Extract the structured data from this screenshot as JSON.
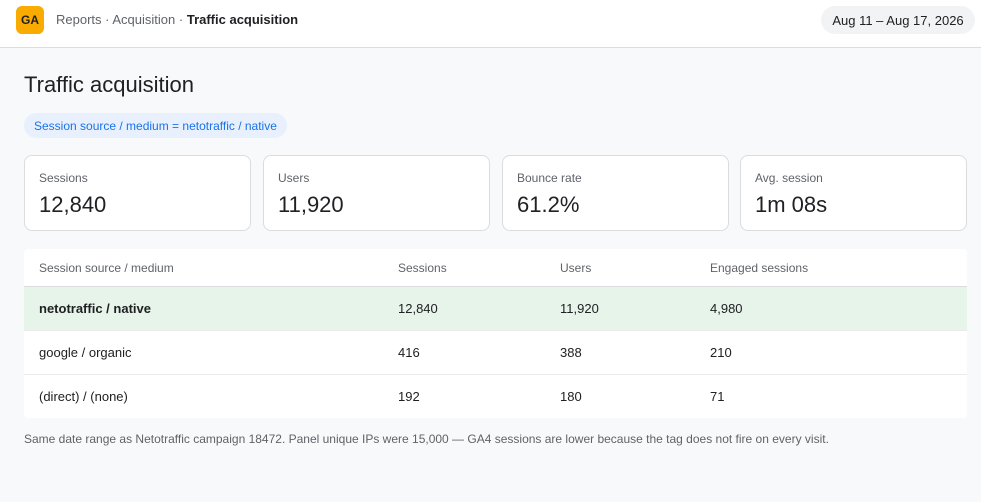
{
  "header": {
    "logo_text": "GA",
    "breadcrumbs": [
      "Reports",
      "Acquisition",
      "Traffic acquisition"
    ],
    "date_range": "Aug 11 – Aug 17, 2026"
  },
  "page": {
    "title": "Traffic acquisition",
    "filter": "Session source / medium = netotraffic / native"
  },
  "metrics": [
    {
      "label": "Sessions",
      "value": "12,840"
    },
    {
      "label": "Users",
      "value": "11,920"
    },
    {
      "label": "Bounce rate",
      "value": "61.2%"
    },
    {
      "label": "Avg. session",
      "value": "1m 08s"
    }
  ],
  "table": {
    "columns": [
      "Session source / medium",
      "Sessions",
      "Users",
      "Engaged sessions"
    ],
    "rows": [
      [
        "netotraffic / native",
        "12,840",
        "11,920",
        "4,980"
      ],
      [
        "google / organic",
        "416",
        "388",
        "210"
      ],
      [
        "(direct) / (none)",
        "192",
        "180",
        "71"
      ]
    ],
    "highlight_color": "#e6f4ea"
  },
  "footnote": "Same date range as Netotraffic campaign 18472. Panel unique IPs were 15,000 — GA4 sessions are lower because the tag does not fire on every visit.",
  "colors": {
    "brand": "#f9ab00",
    "accent": "#1a73e8"
  }
}
